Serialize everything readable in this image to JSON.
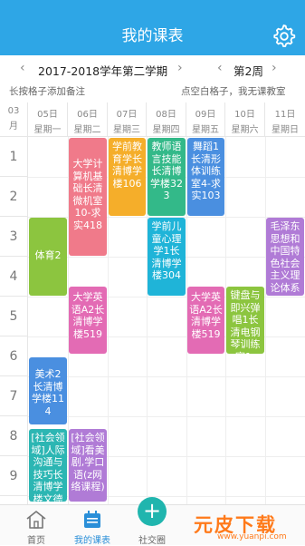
{
  "header": {
    "title": "我的课表"
  },
  "toolbar": {
    "term": "2017-2018学年第二学期",
    "week": "第2周"
  },
  "hints": {
    "left": "长按格子添加备注",
    "right": "点空白格子，我无课教室"
  },
  "month": {
    "num": "03",
    "unit": "月"
  },
  "days": [
    {
      "date": "05日",
      "weekday": "星期一"
    },
    {
      "date": "06日",
      "weekday": "星期二"
    },
    {
      "date": "07日",
      "weekday": "星期三"
    },
    {
      "date": "08日",
      "weekday": "星期四"
    },
    {
      "date": "09日",
      "weekday": "星期五"
    },
    {
      "date": "10日",
      "weekday": "星期六"
    },
    {
      "date": "11日",
      "weekday": "星期日"
    }
  ],
  "periods": [
    "1",
    "2",
    "3",
    "4",
    "5",
    "6",
    "7",
    "8",
    "9",
    "10"
  ],
  "courses": [
    {
      "text": "大学计算机基础长清微机室10-求实418",
      "color": "#f07a8a"
    },
    {
      "text": "学前教育学长清博学楼106",
      "color": "#f5ae2a"
    },
    {
      "text": "教师语言技能长清博学楼323",
      "color": "#33b989"
    },
    {
      "text": "舞蹈1长清形体训练室4-求实103",
      "color": "#4a8fe0"
    },
    {
      "text": "体育2",
      "color": "#8cc53f"
    },
    {
      "text": "学前儿童心理学1长清博学楼304",
      "color": "#1fb4d8"
    },
    {
      "text": "毛泽东思想和中国特色社会主义理论体系",
      "color": "#b07bd6"
    },
    {
      "text": "大学英语A2长清博学楼519",
      "color": "#e36bb4"
    },
    {
      "text": "大学英语A2长清博学楼519",
      "color": "#e36bb4"
    },
    {
      "text": "键盘与即兴弹唱1长清电钢琴训练室1-",
      "color": "#8cc53f"
    },
    {
      "text": "美术2长清博学楼114",
      "color": "#4a8fe0"
    },
    {
      "text": "[社会领域]人际沟通与技巧长清博学楼文德",
      "color": "#2cb6b3"
    },
    {
      "text": "[社会领域]看美剧,学口语(z网络课程)",
      "color": "#b07bd6"
    }
  ],
  "nav": [
    {
      "label": "首页",
      "color": "#666666"
    },
    {
      "label": "我的课表",
      "color": "#2a8fd8"
    },
    {
      "label": "社交圈",
      "color": "#666666"
    }
  ],
  "fab": {
    "symbol": "+"
  },
  "watermark": {
    "logo": "元皮下载",
    "url": "www.yuanpi.com"
  }
}
